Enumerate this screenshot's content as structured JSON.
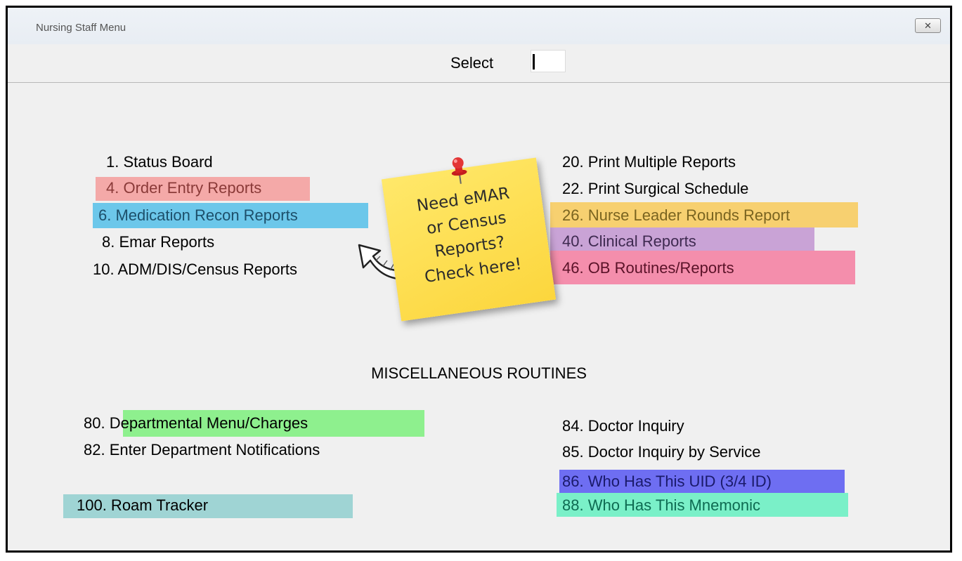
{
  "window": {
    "title": "Nursing Staff Menu",
    "close_icon": "close-icon"
  },
  "prompt": {
    "label": "Select",
    "value": ""
  },
  "menu_left": [
    {
      "label": "1. Status Board",
      "highlight": null
    },
    {
      "label": "4. Order Entry Reports",
      "highlight": "#f4a9a8"
    },
    {
      "label": "6. Medication Recon Reports",
      "highlight": "#6cc7ea"
    },
    {
      "label": "8. Emar Reports",
      "highlight": null
    },
    {
      "label": "10. ADM/DIS/Census Reports",
      "highlight": null
    }
  ],
  "menu_right": [
    {
      "label": "20. Print Multiple Reports",
      "highlight": null
    },
    {
      "label": "22. Print Surgical Schedule",
      "highlight": null
    },
    {
      "label": "26. Nurse Leader Rounds Report",
      "highlight": "#f7d070"
    },
    {
      "label": "40. Clinical Reports",
      "highlight": "#c9a3d6"
    },
    {
      "label": "46. OB Routines/Reports",
      "highlight": "#f48eac"
    }
  ],
  "sticky_note": {
    "text": "Need eMAR\nor Census\nReports?\nCheck here!",
    "pin_icon": "pushpin-icon",
    "arrow_icon": "curved-arrow-icon"
  },
  "misc_heading": "MISCELLANEOUS ROUTINES",
  "misc_left": [
    {
      "label": "80. Departmental Menu/Charges",
      "highlight": "#8ef08e"
    },
    {
      "label": "82. Enter Department Notifications",
      "highlight": null
    },
    {
      "label": "100. Roam Tracker",
      "highlight": "#9fd4d4"
    }
  ],
  "misc_right": [
    {
      "label": "84. Doctor Inquiry",
      "highlight": null
    },
    {
      "label": "85. Doctor Inquiry by Service",
      "highlight": null
    },
    {
      "label": "86. Who Has This UID (3/4 ID)",
      "highlight": "#6e6ef2"
    },
    {
      "label": "88. Who Has This Mnemonic",
      "highlight": "#7af0c8"
    }
  ]
}
